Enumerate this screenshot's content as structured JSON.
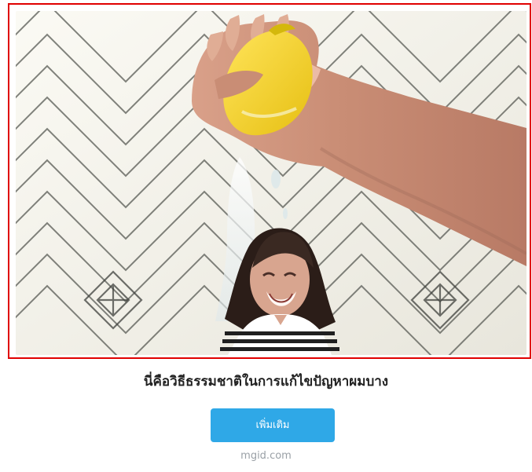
{
  "ad": {
    "headline": "นี่คือวิธีธรรมชาติในการแก้ไขปัญหาผมบาง",
    "cta_label": "เพิ่มเติม",
    "source": "mgid.com"
  },
  "colors": {
    "frame_border": "#e00000",
    "button_bg": "#2fa8e7",
    "button_text": "#ffffff",
    "headline_text": "#222222",
    "source_text": "#9aa0a6",
    "wall": "#f2f0e8",
    "lemon": "#f5d52f"
  },
  "icons": {
    "image_subject": "lemon-squeeze-photo"
  }
}
